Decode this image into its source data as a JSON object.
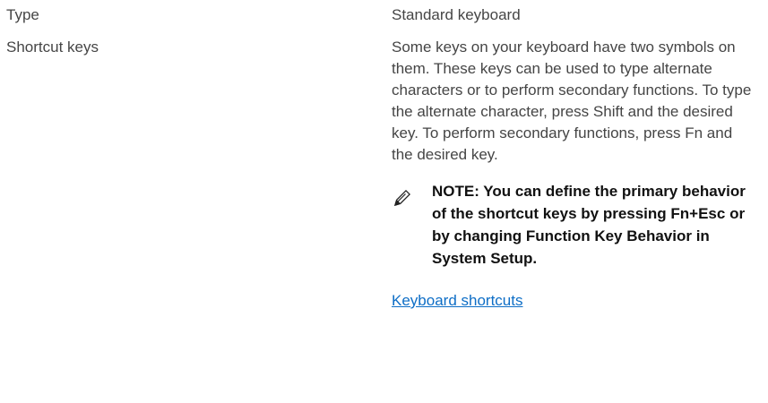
{
  "rows": [
    {
      "label": "Type",
      "value": "Standard keyboard"
    },
    {
      "label": "Shortcut keys",
      "value": "Some keys on your keyboard have two symbols on them. These keys can be used to type alternate characters or to perform secondary functions. To type the alternate character, press Shift and the desired key. To perform secondary functions, press Fn and the desired key.",
      "note": {
        "icon": "pencil-note-icon",
        "text": "NOTE: You can define the primary behavior of the shortcut keys by pressing Fn+Esc or by changing Function Key Behavior in System Setup."
      },
      "link": "Keyboard shortcuts"
    }
  ],
  "colors": {
    "text": "#454545",
    "note_text": "#111111",
    "link": "#0e6ec6"
  }
}
